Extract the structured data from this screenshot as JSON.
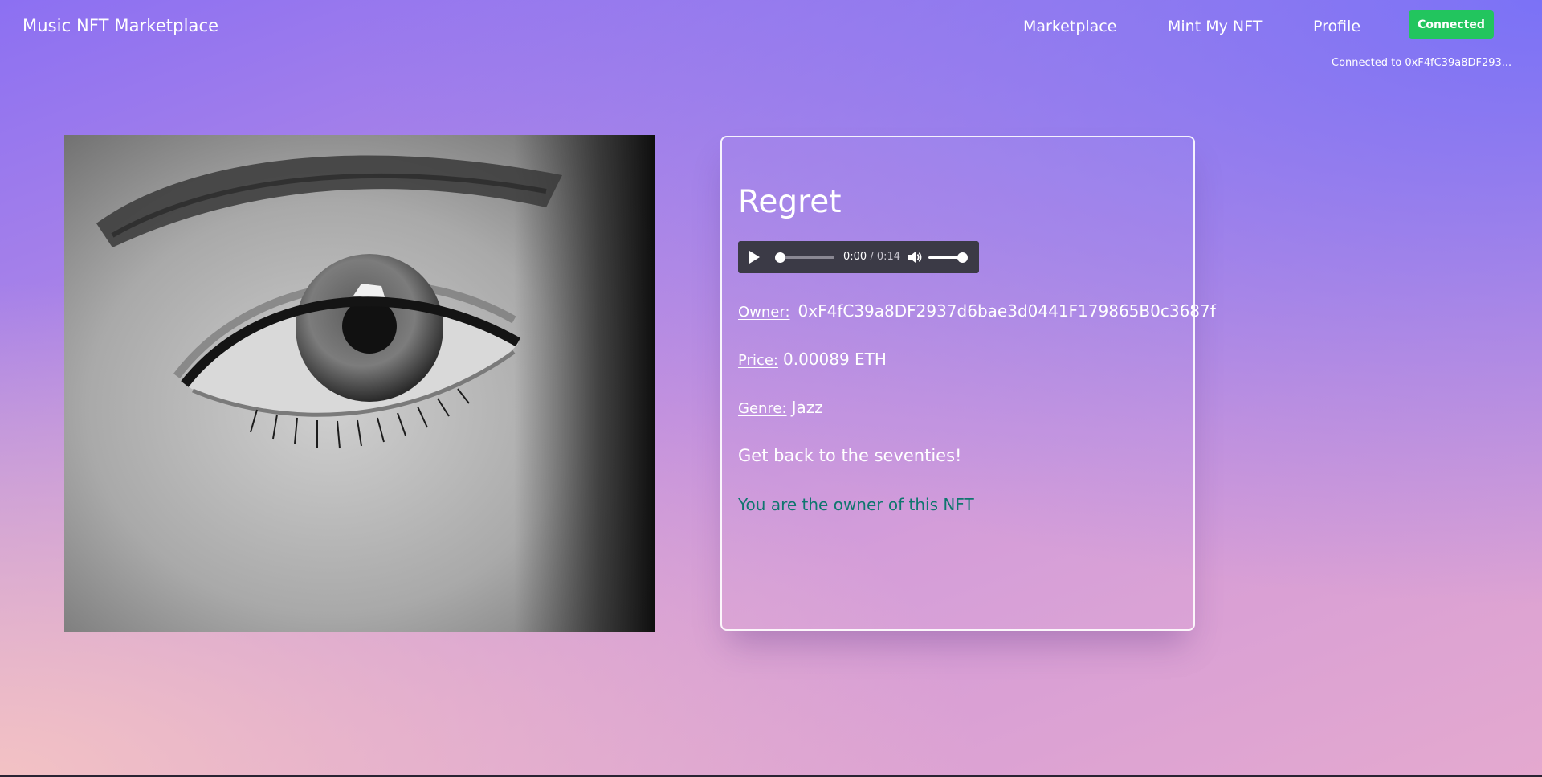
{
  "navbar": {
    "brand": "Music NFT Marketplace",
    "links": [
      "Marketplace",
      "Mint My NFT",
      "Profile"
    ],
    "connect_button": "Connected",
    "wallet_status": "Connected to 0xF4fC39a8DF293..."
  },
  "nft": {
    "title": "Regret",
    "player": {
      "current_time": "0:00",
      "separator": " / ",
      "duration": "0:14",
      "progress": 0,
      "volume": 1
    },
    "owner_label": "Owner:",
    "owner": "0xF4fC39a8DF2937d6bae3d0441F179865B0c3687f",
    "price_label": "Price:",
    "price": "0.00089 ETH",
    "genre_label": "Genre:",
    "genre": "Jazz",
    "description": "Get back to the seventies!",
    "ownership_note": "You are the owner of this NFT"
  },
  "colors": {
    "connect_button": "#22c55e",
    "ownership_note": "#0f766e",
    "player_background": "#3b3a46"
  },
  "icons": {
    "play": "play-icon",
    "volume": "volume-icon"
  }
}
